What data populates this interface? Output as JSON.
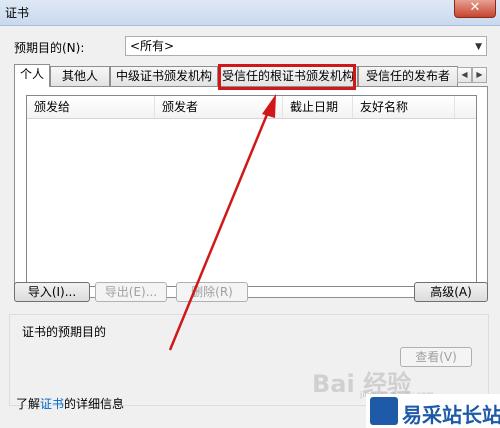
{
  "window": {
    "title": "证书",
    "close_symbol": "✕"
  },
  "purpose": {
    "label": "预期目的(N):",
    "selected": "<所有>"
  },
  "tabs": [
    {
      "label": "个人"
    },
    {
      "label": "其他人"
    },
    {
      "label": "中级证书颁发机构"
    },
    {
      "label": "受信任的根证书颁发机构"
    },
    {
      "label": "受信任的发布者"
    }
  ],
  "list": {
    "columns": [
      "颁发给",
      "颁发者",
      "截止日期",
      "友好名称"
    ]
  },
  "buttons": {
    "import": "导入(I)...",
    "export": "导出(E)...",
    "remove": "删除(R)",
    "advanced": "高级(A)",
    "view": "查看(V)"
  },
  "group": {
    "title": "证书的预期目的"
  },
  "learn_more": {
    "prefix": "了解",
    "link": "证书",
    "suffix": "的详细信息"
  },
  "watermark": {
    "main": "Bai  经验",
    "sub": "jingyan.baidu.com"
  },
  "logo": {
    "text": "易采站长站"
  },
  "colors": {
    "highlight": "#d01818",
    "link": "#0066cc",
    "logo": "#1e5aa8"
  }
}
